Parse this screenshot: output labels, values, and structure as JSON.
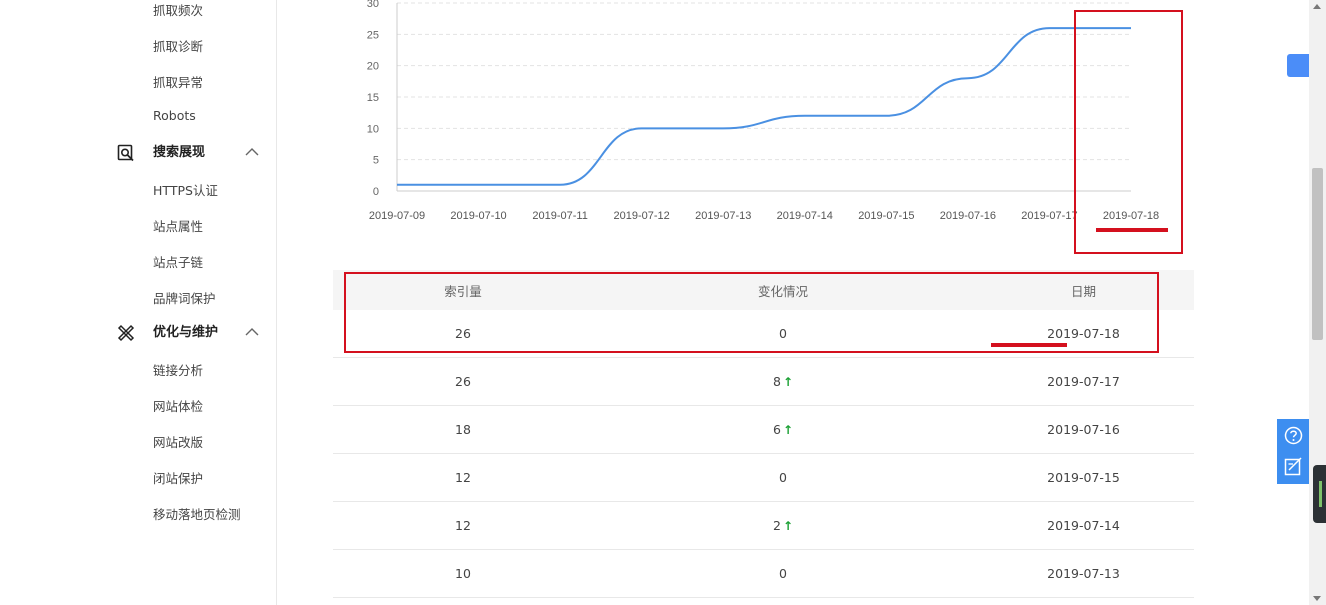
{
  "sidebar": {
    "items_top": [
      "抓取频次",
      "抓取诊断",
      "抓取异常",
      "Robots"
    ],
    "group_search": {
      "label": "搜索展现",
      "icon": "search-display-icon",
      "items": [
        "HTTPS认证",
        "站点属性",
        "站点子链",
        "品牌词保护"
      ]
    },
    "group_optimize": {
      "label": "优化与维护",
      "icon": "optimize-tools-icon",
      "items": [
        "链接分析",
        "网站体检",
        "网站改版",
        "闭站保护",
        "移动落地页检测"
      ]
    }
  },
  "chart_data": {
    "type": "line",
    "x": [
      "2019-07-09",
      "2019-07-10",
      "2019-07-11",
      "2019-07-12",
      "2019-07-13",
      "2019-07-14",
      "2019-07-15",
      "2019-07-16",
      "2019-07-17",
      "2019-07-18"
    ],
    "series": [
      {
        "values": [
          1,
          1,
          1,
          10,
          10,
          12,
          12,
          18,
          26,
          26
        ],
        "color": "#4a90e2"
      }
    ],
    "yticks": [
      "0",
      "5",
      "10",
      "15",
      "20",
      "25",
      "30"
    ],
    "ylim": [
      0,
      30
    ],
    "grid": true,
    "smooth": true
  },
  "table": {
    "headers": [
      "索引量",
      "变化情况",
      "日期"
    ],
    "rows": [
      {
        "index": "26",
        "change": "0",
        "up": false,
        "date": "2019-07-18"
      },
      {
        "index": "26",
        "change": "8",
        "up": true,
        "date": "2019-07-17"
      },
      {
        "index": "18",
        "change": "6",
        "up": true,
        "date": "2019-07-16"
      },
      {
        "index": "12",
        "change": "0",
        "up": false,
        "date": "2019-07-15"
      },
      {
        "index": "12",
        "change": "2",
        "up": true,
        "date": "2019-07-14"
      },
      {
        "index": "10",
        "change": "0",
        "up": false,
        "date": "2019-07-13"
      }
    ],
    "up_arrow": "🠕"
  },
  "colors": {
    "accent": "#4a90e2",
    "annotation": "#d4101e",
    "increase": "#1aa033"
  },
  "floats": {
    "icons": [
      "help-icon",
      "feedback-icon"
    ]
  }
}
